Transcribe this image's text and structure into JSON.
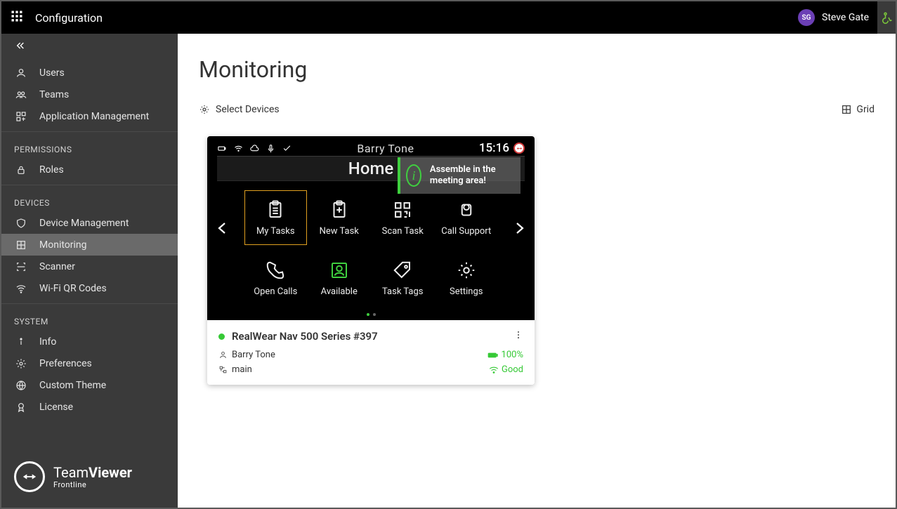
{
  "header": {
    "title": "Configuration",
    "user_initials": "SG",
    "user_name": "Steve Gate"
  },
  "sidebar": {
    "groups": [
      {
        "heading": null,
        "items": [
          {
            "label": "Users",
            "icon": "user"
          },
          {
            "label": "Teams",
            "icon": "users"
          },
          {
            "label": "Application Management",
            "icon": "apps-add"
          }
        ]
      },
      {
        "heading": "PERMISSIONS",
        "items": [
          {
            "label": "Roles",
            "icon": "lock"
          }
        ]
      },
      {
        "heading": "DEVICES",
        "items": [
          {
            "label": "Device Management",
            "icon": "shield"
          },
          {
            "label": "Monitoring",
            "icon": "grid",
            "active": true
          },
          {
            "label": "Scanner",
            "icon": "scan"
          },
          {
            "label": "Wi-Fi QR Codes",
            "icon": "wifi"
          }
        ]
      },
      {
        "heading": "SYSTEM",
        "items": [
          {
            "label": "Info",
            "icon": "info"
          },
          {
            "label": "Preferences",
            "icon": "gear"
          },
          {
            "label": "Custom Theme",
            "icon": "globe"
          },
          {
            "label": "License",
            "icon": "ribbon"
          }
        ]
      }
    ],
    "footer_brand_main": "Team",
    "footer_brand_bold": "Viewer",
    "footer_brand_sub": "Frontline"
  },
  "page": {
    "title": "Monitoring",
    "select_devices_label": "Select Devices",
    "grid_label": "Grid"
  },
  "device": {
    "status_user": "Barry Tone",
    "status_time": "15:16",
    "home_label": "Home",
    "toast_message": "Assemble in the meeting area!",
    "tiles": [
      {
        "label": "My Tasks",
        "icon": "clipboard-list",
        "highlight": true
      },
      {
        "label": "New Task",
        "icon": "clipboard-plus"
      },
      {
        "label": "Scan Task",
        "icon": "qr"
      },
      {
        "label": "Call Support",
        "icon": "headset"
      },
      {
        "label": "Open Calls",
        "icon": "phone"
      },
      {
        "label": "Available",
        "icon": "user-box",
        "green": true
      },
      {
        "label": "Task Tags",
        "icon": "tag"
      },
      {
        "label": "Settings",
        "icon": "gear"
      }
    ],
    "card_name": "RealWear Nav 500 Series #397",
    "card_user": "Barry Tone",
    "battery": "100%",
    "network_name": "main",
    "signal": "Good"
  }
}
